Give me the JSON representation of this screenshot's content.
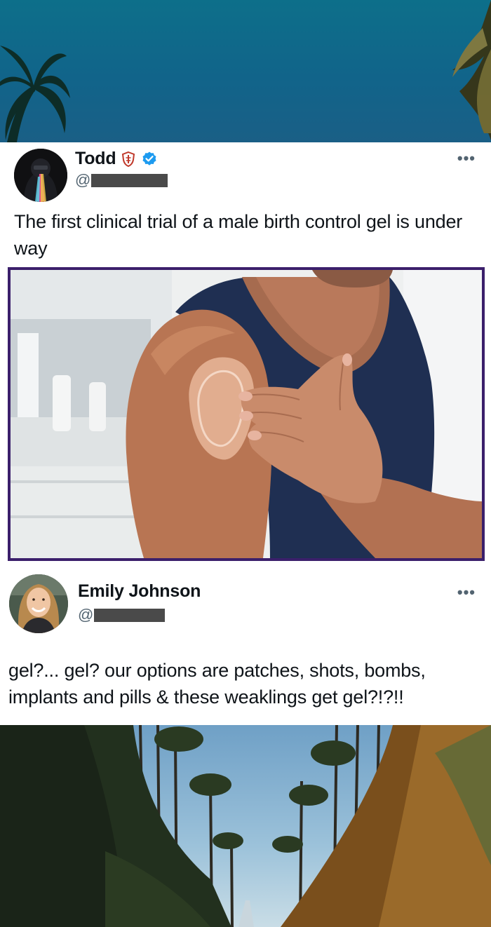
{
  "tweet_1": {
    "display_name": "Todd",
    "handle_prefix": "@",
    "text": "The first clinical trial of a male birth control gel is under way",
    "more_menu": "•••",
    "verified_color": "#1d9bf0",
    "shield_color": "#c0392b"
  },
  "tweet_2": {
    "display_name": "Emily Johnson",
    "handle_prefix": "@",
    "text": "gel?... gel? our options are patches, shots, bombs, implants and pills & these weaklings get gel?!?!!",
    "more_menu": "•••"
  },
  "media": {
    "border_color": "#3b1f6b"
  },
  "icons": {
    "verified": "verified-check-icon",
    "shield": "shield-badge-icon",
    "more": "more-options-icon"
  }
}
